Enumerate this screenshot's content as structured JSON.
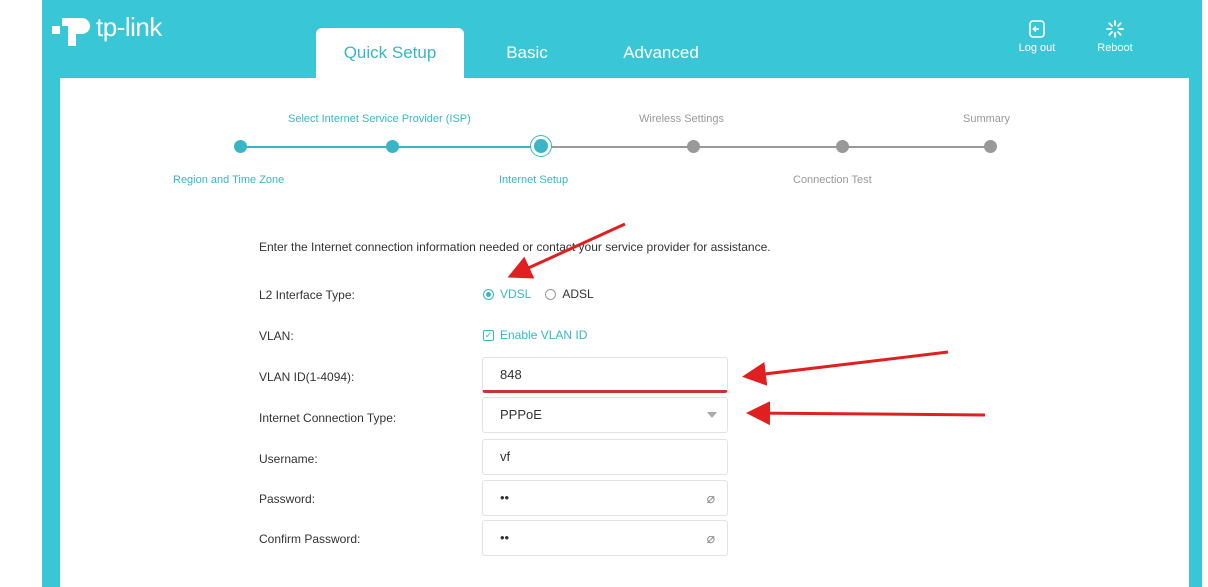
{
  "brand": {
    "name": "tp-link",
    "accent": "#39c6d6",
    "arrow_color": "#e02020"
  },
  "tabs": [
    "Quick Setup",
    "Basic",
    "Advanced"
  ],
  "top_actions": {
    "logout": "Log out",
    "reboot": "Reboot"
  },
  "wizard": {
    "steps_top": [
      "Select Internet Service Provider (ISP)",
      "Wireless Settings",
      "Summary"
    ],
    "steps_bottom": [
      "Region and Time Zone",
      "Internet Setup",
      "Connection Test"
    ]
  },
  "form": {
    "intro": "Enter the Internet connection information needed or contact your service provider for assistance.",
    "l2_label": "L2 Interface Type:",
    "l2_options": [
      "VDSL",
      "ADSL"
    ],
    "l2_selected": "VDSL",
    "vlan_label": "VLAN:",
    "vlan_checkbox": "Enable VLAN ID",
    "vlan_id_label": "VLAN ID(1-4094):",
    "vlan_id_value": "848",
    "conn_type_label": "Internet Connection Type:",
    "conn_type_value": "PPPoE",
    "username_label": "Username:",
    "username_value": "vf",
    "password_label": "Password:",
    "password_value": "••",
    "confirm_label": "Confirm Password:",
    "confirm_value": "••"
  }
}
